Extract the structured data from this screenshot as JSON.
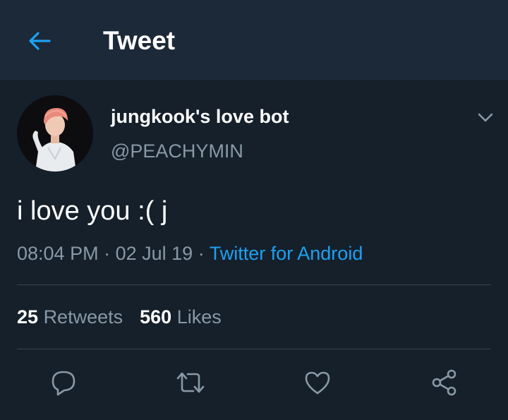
{
  "header": {
    "title": "Tweet",
    "back_icon": "arrow-left-icon"
  },
  "colors": {
    "background": "#15202b",
    "header_background": "#1c2938",
    "accent": "#1da1f2",
    "secondary_text": "#8899a6",
    "divider": "#38444d"
  },
  "tweet": {
    "author": {
      "display_name": "jungkook's love bot",
      "handle": "@PEACHYMIN",
      "avatar_icon": "avatar"
    },
    "menu_icon": "chevron-down-icon",
    "text": "i love you :( j",
    "time": "08:04 PM",
    "separator": "·",
    "date": "02 Jul 19",
    "source": "Twitter for Android",
    "stats": {
      "retweets_count": "25",
      "retweets_label": "Retweets",
      "likes_count": "560",
      "likes_label": "Likes"
    }
  },
  "actions": [
    {
      "name": "reply",
      "icon": "reply-icon"
    },
    {
      "name": "retweet",
      "icon": "retweet-icon"
    },
    {
      "name": "like",
      "icon": "heart-icon"
    },
    {
      "name": "share",
      "icon": "share-icon"
    }
  ]
}
